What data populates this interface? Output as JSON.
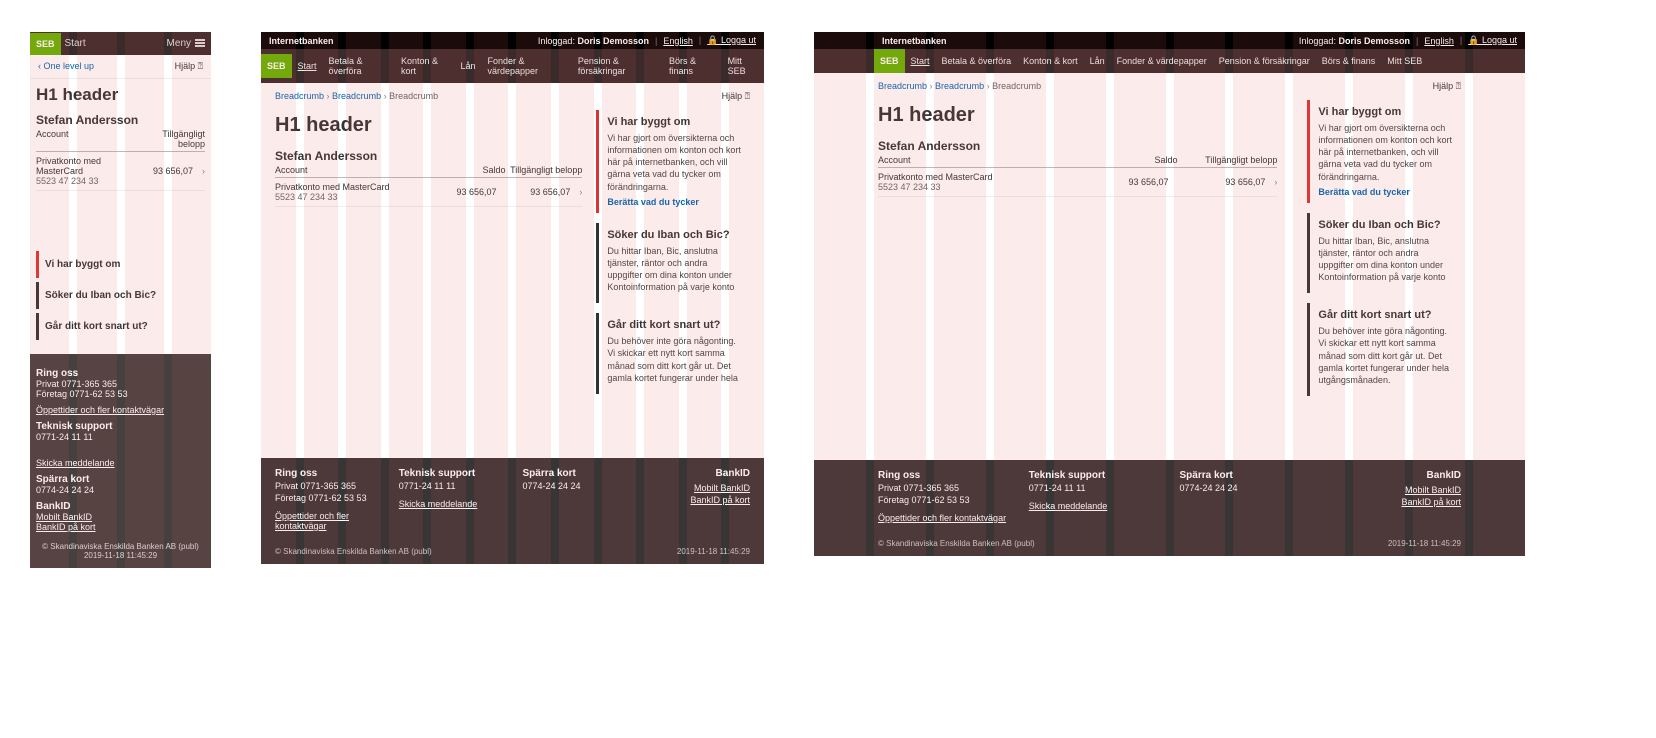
{
  "brand": "SEB",
  "app_name": "Internetbanken",
  "logged_in_label": "Inloggad:",
  "user_name": "Doris Demosson",
  "lang_link": "English",
  "logout": "Logga ut",
  "nav": {
    "start": "Start",
    "items": [
      "Betala & överföra",
      "Konton & kort",
      "Lån",
      "Fonder & värdepapper",
      "Pension & försäkringar",
      "Börs & finans",
      "Mitt SEB"
    ]
  },
  "mobile_nav": {
    "title": "Start",
    "menu": "Meny",
    "back": "One level up"
  },
  "help": "Hjälp",
  "breadcrumbs": {
    "a": "Breadcrumb",
    "b": "Breadcrumb",
    "c": "Breadcrumb"
  },
  "h1": "H1 header",
  "account": {
    "owner": "Stefan Andersson",
    "col_account": "Account",
    "col_saldo": "Saldo",
    "col_available": "Tillgängligt belopp",
    "row": {
      "name": "Privatkonto med MasterCard",
      "number": "5523 47 234 33",
      "saldo": "93 656,07",
      "available": "93 656,07"
    }
  },
  "cards": {
    "rebuild": {
      "title": "Vi har byggt om",
      "body_tablet": "Vi har gjort om översikterna och informationen om konton och kort här på internetbanken, och vill gärna veta vad du tycker om förändringarna.",
      "body_desktop": "Vi har gjort om översikterna och informationen om konton och kort här på internetbanken, och vill gärna veta vad du tycker om förändringarna.",
      "link": "Berätta vad du tycker"
    },
    "iban": {
      "title": "Söker du Iban och Bic?",
      "body": "Du hittar Iban, Bic, anslutna tjänster, räntor och andra uppgifter om dina konton under Kontoinformation på varje konto"
    },
    "kort": {
      "title": "Går ditt kort snart ut?",
      "body_tablet": "Du behöver inte göra någonting. Vi skickar ett nytt kort samma månad som ditt kort går ut. Det gamla kortet fungerar under hela",
      "body_desktop": "Du behöver inte göra någonting. Vi skickar ett nytt kort samma månad som ditt kort går ut. Det gamla kortet fungerar under hela utgångsmånaden."
    }
  },
  "footer": {
    "ring": {
      "title": "Ring oss",
      "privat": "Privat 0771-365 365",
      "foretag": "Företag 0771-62 53 53"
    },
    "openings": "Öppettider och fler kontaktvägar",
    "send_msg": "Skicka meddelande",
    "support": {
      "title": "Teknisk support",
      "num": "0771-24 11 11"
    },
    "block": {
      "title": "Spärra kort",
      "num": "0774-24 24 24"
    },
    "bankid": {
      "title": "BankID",
      "mobilt": "Mobilt BankID",
      "kort": "BankID på kort"
    },
    "legal": "© Skandinaviska Enskilda Banken AB (publ)",
    "timestamp": "2019-11-18 11:45:29"
  },
  "mobile_footer_links": {
    "openings": "Öppettider och fler kontaktvägar",
    "send": "Skicka meddelande"
  }
}
